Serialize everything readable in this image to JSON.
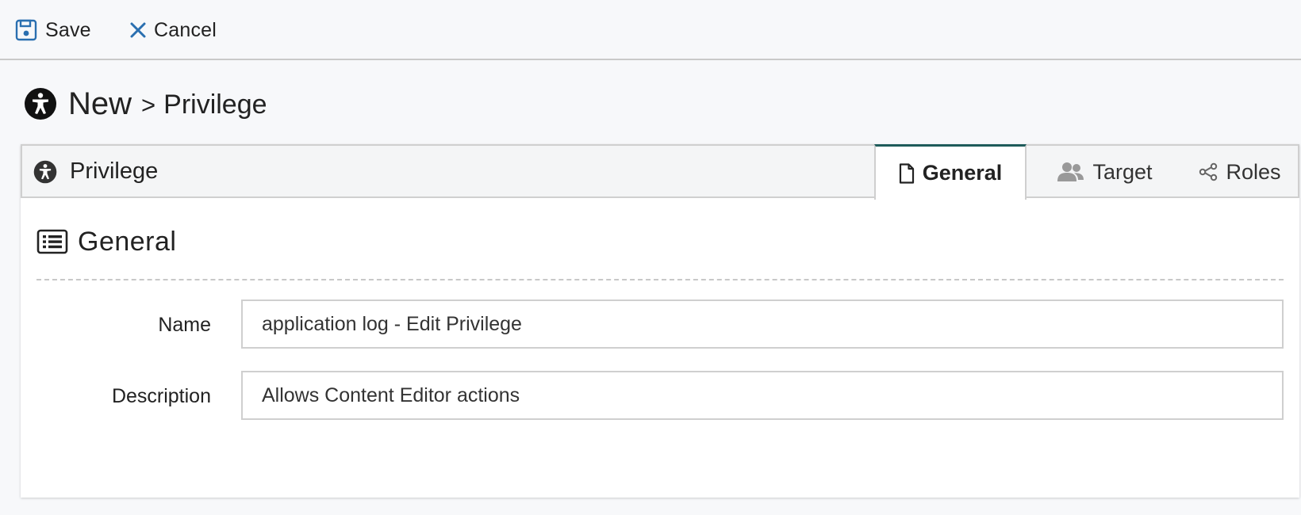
{
  "toolbar": {
    "save_label": "Save",
    "cancel_label": "Cancel",
    "save_icon": "floppy-disk-icon",
    "cancel_icon": "close-icon",
    "accent_color": "#2a6fb0"
  },
  "heading": {
    "icon": "accessibility-icon",
    "new_label": "New",
    "separator": ">",
    "entity_label": "Privilege"
  },
  "card": {
    "title": "Privilege",
    "title_icon": "accessibility-icon",
    "tabs": [
      {
        "label": "General",
        "icon": "file-icon",
        "active": true
      },
      {
        "label": "Target",
        "icon": "users-icon",
        "active": false
      },
      {
        "label": "Roles",
        "icon": "share-nodes-icon",
        "active": false
      }
    ],
    "active_tab_color": "#1e5b5a"
  },
  "section": {
    "title": "General",
    "icon": "list-icon",
    "fields": {
      "name": {
        "label": "Name",
        "value": "application log - Edit Privilege"
      },
      "description": {
        "label": "Description",
        "value": "Allows Content Editor actions"
      }
    }
  }
}
